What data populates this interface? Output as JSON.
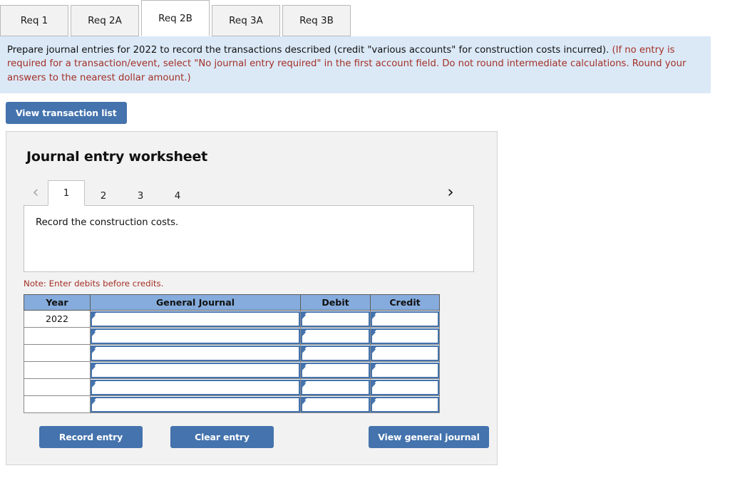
{
  "req_tabs": [
    {
      "label": "Req 1",
      "active": false
    },
    {
      "label": "Req 2A",
      "active": false
    },
    {
      "label": "Req 2B",
      "active": true
    },
    {
      "label": "Req 3A",
      "active": false
    },
    {
      "label": "Req 3B",
      "active": false
    }
  ],
  "instructions": {
    "main": "Prepare journal entries for 2022 to record the transactions described (credit \"various accounts\" for construction costs incurred). ",
    "hint": "(If no entry is required for a transaction/event, select \"No journal entry required\" in the first account field. Do not round intermediate calculations. Round your answers to the nearest dollar amount.)"
  },
  "toolbar": {
    "view_transaction_list_label": "View transaction list"
  },
  "worksheet": {
    "title": "Journal entry worksheet",
    "pager": {
      "prev_icon": "chevron-left-icon",
      "prev_glyph": "‹",
      "next_icon": "chevron-right-icon",
      "next_glyph": "›",
      "pages": [
        {
          "label": "1",
          "active": true
        },
        {
          "label": "2",
          "active": false
        },
        {
          "label": "3",
          "active": false
        },
        {
          "label": "4",
          "active": false
        }
      ]
    },
    "description": "Record the construction costs.",
    "note": "Note: Enter debits before credits.",
    "table": {
      "columns": [
        "Year",
        "General Journal",
        "Debit",
        "Credit"
      ],
      "rows": [
        {
          "year": "2022",
          "general_journal": "",
          "debit": "",
          "credit": ""
        },
        {
          "year": "",
          "general_journal": "",
          "debit": "",
          "credit": ""
        },
        {
          "year": "",
          "general_journal": "",
          "debit": "",
          "credit": ""
        },
        {
          "year": "",
          "general_journal": "",
          "debit": "",
          "credit": ""
        },
        {
          "year": "",
          "general_journal": "",
          "debit": "",
          "credit": ""
        },
        {
          "year": "",
          "general_journal": "",
          "debit": "",
          "credit": ""
        }
      ]
    },
    "buttons": {
      "record_entry": "Record entry",
      "clear_entry": "Clear entry",
      "view_general_journal": "View general journal"
    }
  },
  "colors": {
    "accent_blue": "#4473ad",
    "table_header_blue": "#85acdc",
    "instruction_bg": "#dbe9f7",
    "hint_red": "#a33026",
    "panel_bg": "#f2f2f2"
  }
}
